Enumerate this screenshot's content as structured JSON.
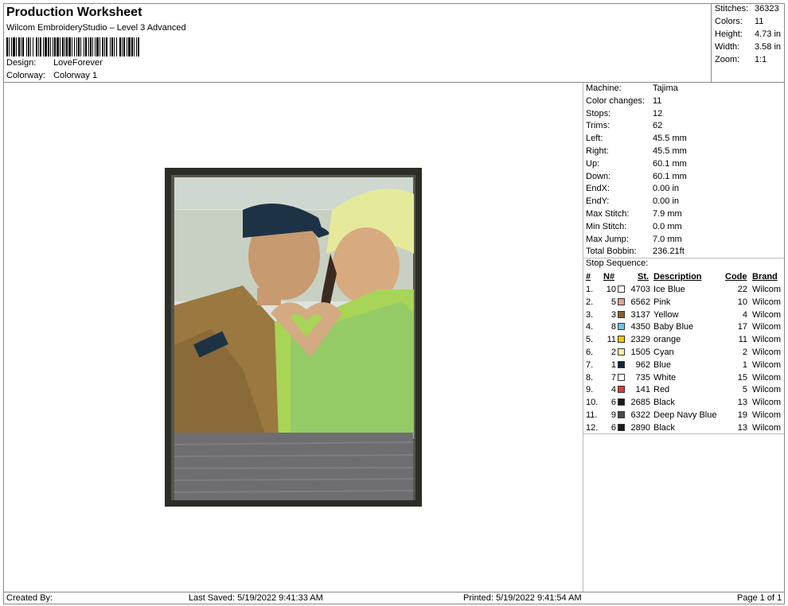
{
  "header": {
    "title": "Production Worksheet",
    "subtitle": "Wilcom EmbroideryStudio – Level 3 Advanced",
    "design_label": "Design:",
    "design_value": "LoveForever",
    "colorway_label": "Colorway:",
    "colorway_value": "Colorway 1"
  },
  "stats": [
    {
      "label": "Stitches:",
      "value": "36323"
    },
    {
      "label": "Colors:",
      "value": "11"
    },
    {
      "label": "Height:",
      "value": "4.73 in"
    },
    {
      "label": "Width:",
      "value": "3.58 in"
    },
    {
      "label": "Zoom:",
      "value": "1:1"
    }
  ],
  "machine_info": [
    {
      "label": "Machine:",
      "value": "Tajima"
    },
    {
      "label": "Color changes:",
      "value": "11"
    },
    {
      "label": "Stops:",
      "value": "12"
    },
    {
      "label": "Trims:",
      "value": "62"
    },
    {
      "label": "Left:",
      "value": "45.5 mm"
    },
    {
      "label": "Right:",
      "value": "45.5 mm"
    },
    {
      "label": "Up:",
      "value": "60.1 mm"
    },
    {
      "label": "Down:",
      "value": "60.1 mm"
    },
    {
      "label": "EndX:",
      "value": "0.00 in"
    },
    {
      "label": "EndY:",
      "value": "0.00 in"
    },
    {
      "label": "Max Stitch:",
      "value": "7.9 mm"
    },
    {
      "label": "Min Stitch:",
      "value": "0.0 mm"
    },
    {
      "label": "Max Jump:",
      "value": "7.0 mm"
    },
    {
      "label": "Total Bobbin:",
      "value": "236.21ft"
    }
  ],
  "stop_sequence": {
    "title": "Stop Sequence:",
    "headers": {
      "num": "#",
      "n": "N#",
      "st": "St.",
      "desc": "Description",
      "code": "Code",
      "brand": "Brand"
    },
    "rows": [
      {
        "num": "1.",
        "n": "10",
        "st": "4703",
        "desc": "Ice Blue",
        "code": "22",
        "brand": "Wilcom",
        "color": "#ffffff"
      },
      {
        "num": "2.",
        "n": "5",
        "st": "6562",
        "desc": "Pink",
        "code": "10",
        "brand": "Wilcom",
        "color": "#e8a48c"
      },
      {
        "num": "3.",
        "n": "3",
        "st": "3137",
        "desc": "Yellow",
        "code": "4",
        "brand": "Wilcom",
        "color": "#8b5e32"
      },
      {
        "num": "4.",
        "n": "8",
        "st": "4350",
        "desc": "Baby Blue",
        "code": "17",
        "brand": "Wilcom",
        "color": "#6ec6e6"
      },
      {
        "num": "5.",
        "n": "11",
        "st": "2329",
        "desc": "orange",
        "code": "11",
        "brand": "Wilcom",
        "color": "#f2c800"
      },
      {
        "num": "6.",
        "n": "2",
        "st": "1505",
        "desc": "Cyan",
        "code": "2",
        "brand": "Wilcom",
        "color": "#f6f2a2"
      },
      {
        "num": "7.",
        "n": "1",
        "st": "962",
        "desc": "Blue",
        "code": "1",
        "brand": "Wilcom",
        "color": "#0e2440"
      },
      {
        "num": "8.",
        "n": "7",
        "st": "735",
        "desc": "White",
        "code": "15",
        "brand": "Wilcom",
        "color": "#ffffff"
      },
      {
        "num": "9.",
        "n": "4",
        "st": "141",
        "desc": "Red",
        "code": "5",
        "brand": "Wilcom",
        "color": "#e03a3a"
      },
      {
        "num": "10.",
        "n": "6",
        "st": "2685",
        "desc": "Black",
        "code": "13",
        "brand": "Wilcom",
        "color": "#1a1a1a"
      },
      {
        "num": "11.",
        "n": "9",
        "st": "6322",
        "desc": "Deep Navy Blue",
        "code": "19",
        "brand": "Wilcom",
        "color": "#4a4a55"
      },
      {
        "num": "12.",
        "n": "6",
        "st": "2890",
        "desc": "Black",
        "code": "13",
        "brand": "Wilcom",
        "color": "#1a1a1a"
      }
    ]
  },
  "footer": {
    "created_by": "Created By:",
    "last_saved": "Last Saved: 5/19/2022 9:41:33 AM",
    "printed": "Printed: 5/19/2022 9:41:54 AM",
    "page": "Page 1 of 1"
  }
}
